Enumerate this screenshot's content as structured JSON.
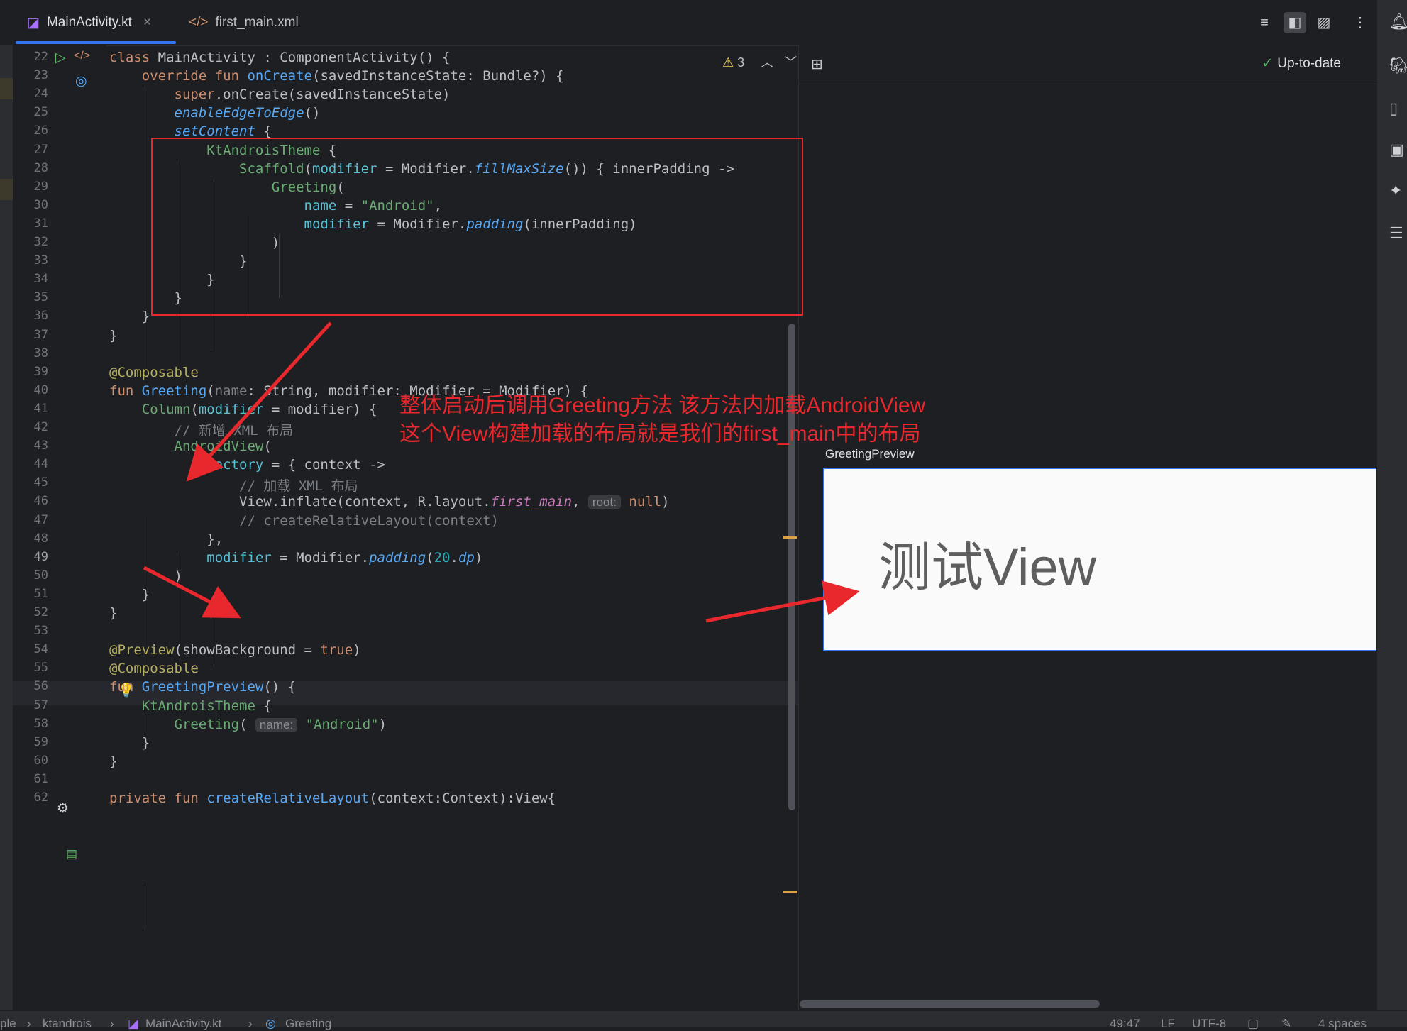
{
  "tabs": [
    {
      "label": "MainActivity.kt",
      "icon": "kotlin-file-icon",
      "active": true
    },
    {
      "label": "first_main.xml",
      "icon": "xml-file-icon",
      "active": false
    }
  ],
  "editor": {
    "warnings": "3",
    "current_line": 49,
    "lines": [
      {
        "n": "22"
      },
      {
        "n": "23"
      },
      {
        "n": "24"
      },
      {
        "n": "25"
      },
      {
        "n": "26"
      },
      {
        "n": "27"
      },
      {
        "n": "28"
      },
      {
        "n": "29"
      },
      {
        "n": "30"
      },
      {
        "n": "31"
      },
      {
        "n": "32"
      },
      {
        "n": "33"
      },
      {
        "n": "34"
      },
      {
        "n": "35"
      },
      {
        "n": "36"
      },
      {
        "n": "37"
      },
      {
        "n": "38"
      },
      {
        "n": "39"
      },
      {
        "n": "40"
      },
      {
        "n": "41"
      },
      {
        "n": "42"
      },
      {
        "n": "43"
      },
      {
        "n": "44"
      },
      {
        "n": "45"
      },
      {
        "n": "46"
      },
      {
        "n": "47"
      },
      {
        "n": "48"
      },
      {
        "n": "49"
      },
      {
        "n": "50"
      },
      {
        "n": "51"
      },
      {
        "n": "52"
      },
      {
        "n": "53"
      },
      {
        "n": "54"
      },
      {
        "n": "55"
      },
      {
        "n": "56"
      },
      {
        "n": "57"
      },
      {
        "n": "58"
      },
      {
        "n": "59"
      },
      {
        "n": "60"
      },
      {
        "n": "61"
      },
      {
        "n": "62"
      }
    ],
    "code": {
      "l22": [
        [
          "kw",
          "class "
        ],
        [
          "t",
          "MainActivity : ComponentActivity() {"
        ]
      ],
      "l23": [
        [
          "t",
          "    "
        ],
        [
          "kw",
          "override fun "
        ],
        [
          "fn",
          "onCreate"
        ],
        [
          "t",
          "(savedInstanceState: Bundle?) {"
        ]
      ],
      "l24": [
        [
          "t",
          "        "
        ],
        [
          "kw",
          "super"
        ],
        [
          "t",
          ".onCreate(savedInstanceState)"
        ]
      ],
      "l25": [
        [
          "t",
          "        "
        ],
        [
          "fni",
          "enableEdgeToEdge"
        ],
        [
          "t",
          "()"
        ]
      ],
      "l26": [
        [
          "t",
          "        "
        ],
        [
          "fni",
          "setContent"
        ],
        [
          "t",
          " {"
        ]
      ],
      "l27": [
        [
          "t",
          "            "
        ],
        [
          "cls",
          "KtAndroisTheme"
        ],
        [
          "t",
          " {"
        ]
      ],
      "l28": [
        [
          "t",
          "                "
        ],
        [
          "cls",
          "Scaffold"
        ],
        [
          "t",
          "("
        ],
        [
          "param",
          "modifier"
        ],
        [
          "t",
          " = Modifier."
        ],
        [
          "fni",
          "fillMaxSize"
        ],
        [
          "t",
          "()) { innerPadding ->"
        ]
      ],
      "l29": [
        [
          "t",
          "                    "
        ],
        [
          "cls",
          "Greeting"
        ],
        [
          "t",
          "("
        ]
      ],
      "l30": [
        [
          "t",
          "                        "
        ],
        [
          "param",
          "name"
        ],
        [
          "t",
          " = "
        ],
        [
          "str",
          "\"Android\""
        ],
        [
          "t",
          ","
        ]
      ],
      "l31": [
        [
          "t",
          "                        "
        ],
        [
          "param",
          "modifier"
        ],
        [
          "t",
          " = Modifier."
        ],
        [
          "fni",
          "padding"
        ],
        [
          "t",
          "(innerPadding)"
        ]
      ],
      "l32": [
        [
          "t",
          "                    )"
        ]
      ],
      "l33": [
        [
          "t",
          "                }"
        ]
      ],
      "l34": [
        [
          "t",
          "            }"
        ]
      ],
      "l35": [
        [
          "t",
          "        }"
        ]
      ],
      "l36": [
        [
          "t",
          "    }"
        ]
      ],
      "l37": [
        [
          "t",
          "}"
        ]
      ],
      "l38": [],
      "l39": [
        [
          "ann",
          "@Composable"
        ]
      ],
      "l40": [
        [
          "kw",
          "fun "
        ],
        [
          "fn",
          "Greeting"
        ],
        [
          "t",
          "("
        ],
        [
          "cm",
          "name"
        ],
        [
          "t",
          ": String, modifier: Modifier = Modifier) {"
        ]
      ],
      "l41": [
        [
          "t",
          "    "
        ],
        [
          "cls",
          "Column"
        ],
        [
          "t",
          "("
        ],
        [
          "param",
          "modifier"
        ],
        [
          "t",
          " = modifier) {"
        ]
      ],
      "l42": [
        [
          "t",
          "        "
        ],
        [
          "cm",
          "// 新增 XML 布局"
        ]
      ],
      "l43": [
        [
          "t",
          "        "
        ],
        [
          "cls",
          "AndroidView"
        ],
        [
          "t",
          "("
        ]
      ],
      "l44": [
        [
          "t",
          "            "
        ],
        [
          "param",
          "factory"
        ],
        [
          "t",
          " = { context ->"
        ]
      ],
      "l45": [
        [
          "t",
          "                "
        ],
        [
          "cm",
          "// 加载 XML 布局"
        ]
      ],
      "l46": [
        [
          "t",
          "                View.inflate(context, R.layout."
        ],
        [
          "purple",
          "first_main"
        ],
        [
          "t",
          ", "
        ],
        [
          "hint",
          "root:"
        ],
        [
          "kw",
          " null"
        ],
        [
          "t",
          ")"
        ]
      ],
      "l47": [
        [
          "t",
          "                "
        ],
        [
          "cm",
          "// createRelativeLayout(context)"
        ]
      ],
      "l48": [
        [
          "t",
          "            },"
        ]
      ],
      "l49": [
        [
          "t",
          "            "
        ],
        [
          "param",
          "modifier"
        ],
        [
          "t",
          " = Modifier."
        ],
        [
          "fni",
          "padding"
        ],
        [
          "t",
          "("
        ],
        [
          "num",
          "20"
        ],
        [
          "t",
          "."
        ],
        [
          "fni",
          "dp"
        ],
        [
          "t",
          ")"
        ]
      ],
      "l50": [
        [
          "t",
          "        )"
        ]
      ],
      "l51": [
        [
          "t",
          "    }"
        ]
      ],
      "l52": [
        [
          "t",
          "}"
        ]
      ],
      "l53": [],
      "l54": [
        [
          "ann",
          "@Preview"
        ],
        [
          "t",
          "(showBackground = "
        ],
        [
          "kw",
          "true"
        ],
        [
          "t",
          ")"
        ]
      ],
      "l55": [
        [
          "ann",
          "@Composable"
        ]
      ],
      "l56": [
        [
          "kw",
          "fun "
        ],
        [
          "fn",
          "GreetingPreview"
        ],
        [
          "t",
          "() {"
        ]
      ],
      "l57": [
        [
          "t",
          "    "
        ],
        [
          "cls",
          "KtAndroisTheme"
        ],
        [
          "t",
          " {"
        ]
      ],
      "l58": [
        [
          "t",
          "        "
        ],
        [
          "cls",
          "Greeting"
        ],
        [
          "t",
          "( "
        ],
        [
          "hint",
          "name:"
        ],
        [
          "t",
          " "
        ],
        [
          "str",
          "\"Android\""
        ],
        [
          "t",
          ")"
        ]
      ],
      "l59": [
        [
          "t",
          "    }"
        ]
      ],
      "l60": [
        [
          "t",
          "}"
        ]
      ],
      "l61": [],
      "l62": [
        [
          "kw",
          "private fun "
        ],
        [
          "fn",
          "createRelativeLayout"
        ],
        [
          "t",
          "(context:Context):View{"
        ]
      ]
    }
  },
  "annotation": {
    "line1": "整体启动后调用Greeting方法  该方法内加载AndroidView",
    "line2": "这个View构建加载的布局就是我们的first_main中的布局"
  },
  "preview": {
    "status": "Up-to-date",
    "label": "GreetingPreview",
    "text": "测试View"
  },
  "statusbar": {
    "crumb1": "ple",
    "crumb2": "ktandrois",
    "crumb3": "MainActivity.kt",
    "crumb4": "Greeting",
    "position": "49:47",
    "line_sep": "LF",
    "encoding": "UTF-8",
    "indent": "4 spaces"
  },
  "colors": {
    "accent": "#3574f0",
    "annotation": "#e8282d",
    "ok": "#5fb865"
  }
}
